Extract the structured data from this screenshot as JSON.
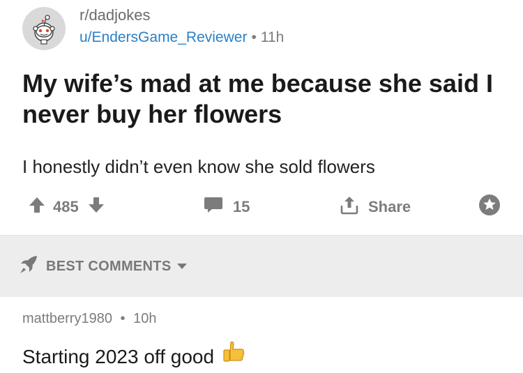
{
  "post": {
    "subreddit": "r/dadjokes",
    "author": "u/EndersGame_Reviewer",
    "separator": "•",
    "time": "11h",
    "avatar_icon": "snoo-avatar-icon",
    "title": "My wife’s mad at me because she said I never buy her flowers",
    "body": "I honestly didn’t even know she sold flowers"
  },
  "actions": {
    "upvote_icon": "arrow-up-icon",
    "vote_count": "485",
    "downvote_icon": "arrow-down-icon",
    "comment_icon": "comment-bubble-icon",
    "comment_count": "15",
    "share_icon": "share-icon",
    "share_label": "Share",
    "award_icon": "award-icon"
  },
  "sort": {
    "icon": "rocket-icon",
    "label": "BEST COMMENTS",
    "caret_icon": "caret-down-icon"
  },
  "comment": {
    "author": "mattberry1980",
    "separator": "•",
    "time": "10h",
    "text": "Starting 2023 off good",
    "emoji_icon": "thumbs-up-icon"
  },
  "colors": {
    "username": "#2a80c7",
    "meta_gray": "#7c7c7c",
    "sort_bar_bg": "#ededed",
    "thumb_yellow": "#f6c03a"
  }
}
